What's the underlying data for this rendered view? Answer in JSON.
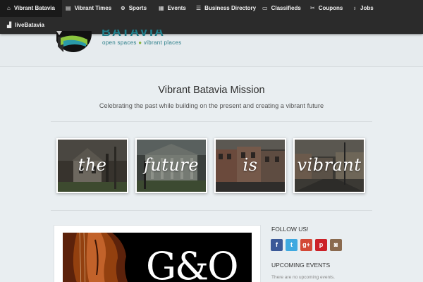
{
  "nav": {
    "items": [
      {
        "label": "Vibrant Batavia",
        "icon": "home-icon",
        "glyph": "⌂",
        "active": true
      },
      {
        "label": "Vibrant Times",
        "icon": "newspaper-icon",
        "glyph": "▤"
      },
      {
        "label": "Sports",
        "icon": "ball-icon",
        "glyph": "⊛"
      },
      {
        "label": "Events",
        "icon": "calendar-icon",
        "glyph": "▦"
      },
      {
        "label": "Business Directory",
        "icon": "list-icon",
        "glyph": "☰"
      },
      {
        "label": "Classifieds",
        "icon": "document-icon",
        "glyph": "▭"
      },
      {
        "label": "Coupons",
        "icon": "scissors-icon",
        "glyph": "✂"
      },
      {
        "label": "Jobs",
        "icon": "pin-icon",
        "glyph": "♁"
      },
      {
        "label": "liveBatavia",
        "icon": "signal-icon",
        "glyph": "▟"
      }
    ]
  },
  "logo": {
    "wordmark": "BATAVIA",
    "tagline_left": "open spaces",
    "tagline_sep": "●",
    "tagline_right": "vibrant places"
  },
  "mission": {
    "title": "Vibrant Batavia Mission",
    "subtitle": "Celebrating the past while building on the present and creating a vibrant future"
  },
  "tiles": [
    {
      "word": "the",
      "scene": "house"
    },
    {
      "word": "future",
      "scene": "courthouse"
    },
    {
      "word": "is",
      "scene": "storefronts"
    },
    {
      "word": "vibrant",
      "scene": "street"
    }
  ],
  "featured": {
    "logo_text": "G&O"
  },
  "sidebar": {
    "follow_heading": "FOLLOW US!",
    "social": [
      {
        "icon": "facebook-icon",
        "glyph": "f",
        "color": "#3b5998"
      },
      {
        "icon": "twitter-icon",
        "glyph": "t",
        "color": "#3fa9e0"
      },
      {
        "icon": "google-plus-icon",
        "glyph": "g+",
        "color": "#d34836"
      },
      {
        "icon": "pinterest-icon",
        "glyph": "p",
        "color": "#cb2027"
      },
      {
        "icon": "instagram-icon",
        "glyph": "◙",
        "color": "#8a6a4f"
      }
    ],
    "events_heading": "UPCOMING EVENTS",
    "events_empty": "There are no upcoming events."
  }
}
